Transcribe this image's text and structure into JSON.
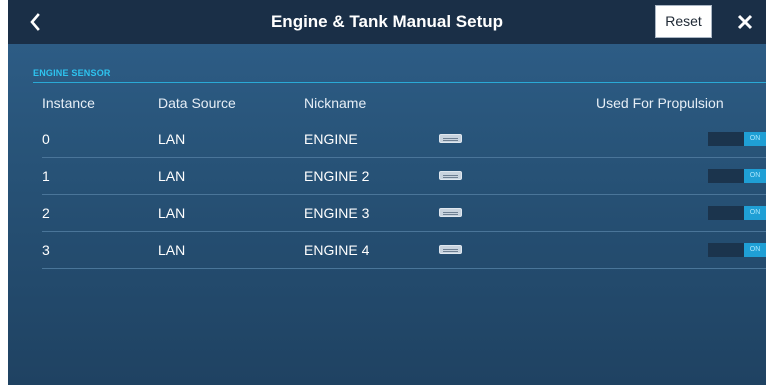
{
  "header": {
    "title": "Engine & Tank Manual Setup",
    "reset_label": "Reset",
    "back_icon": "chevron-left-icon",
    "close_icon": "close-icon"
  },
  "section": {
    "label": "ENGINE SENSOR"
  },
  "columns": {
    "instance": "Instance",
    "data_source": "Data Source",
    "nickname": "Nickname",
    "propulsion": "Used For Propulsion"
  },
  "rows": [
    {
      "instance": "0",
      "data_source": "LAN",
      "nickname": "ENGINE",
      "propulsion": "ON"
    },
    {
      "instance": "1",
      "data_source": "LAN",
      "nickname": "ENGINE 2",
      "propulsion": "ON"
    },
    {
      "instance": "2",
      "data_source": "LAN",
      "nickname": "ENGINE 3",
      "propulsion": "ON"
    },
    {
      "instance": "3",
      "data_source": "LAN",
      "nickname": "ENGINE 4",
      "propulsion": "ON"
    }
  ],
  "colors": {
    "titlebar": "#1a2f47",
    "content": "#285479",
    "accent": "#2ec4f0",
    "toggle_on": "#1f9fd5"
  }
}
